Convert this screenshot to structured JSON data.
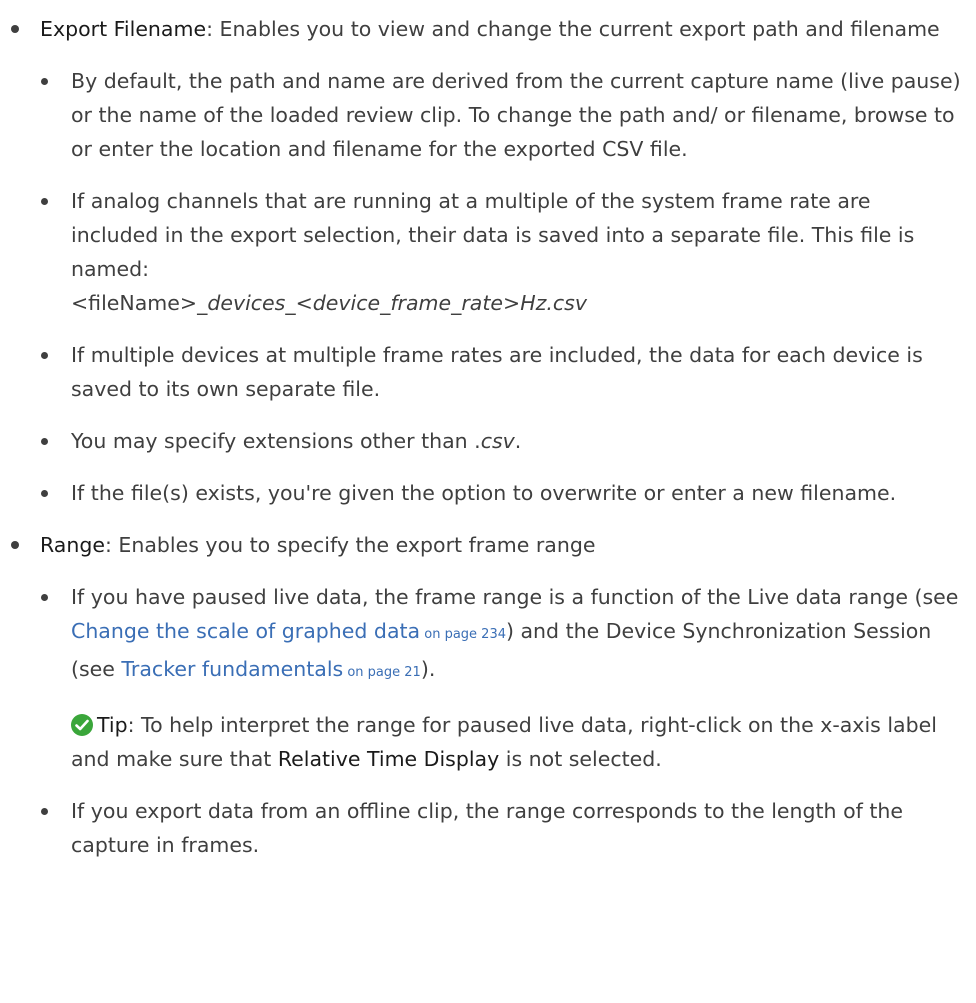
{
  "export_filename": {
    "term": "Export Filename",
    "desc": ": Enables you to view and change the current export path and filename",
    "sub": [
      {
        "text": "By default, the path and name are derived from the current capture name (live pause) or the name of the loaded review clip. To change the path and/ or filename, browse to or enter the location and filename for the exported CSV file."
      },
      {
        "text_a": "If analog channels that are running at a multiple of the system frame rate are included in the export selection, their data is saved into a separate file. This file is named:",
        "file_prefix": "<fileName>",
        "file_italic": "_devices_<device_frame_rate>Hz.csv"
      },
      {
        "text": "If multiple devices at multiple frame rates are included, the data for each device is saved to its own separate file."
      },
      {
        "text_a": "You may specify extensions other than .",
        "text_italic": "csv",
        "text_b": "."
      },
      {
        "text": "If the file(s) exists, you're given the option to overwrite or enter a new filename."
      }
    ]
  },
  "range": {
    "term": "Range",
    "desc": ": Enables you to specify the export frame range",
    "sub1": {
      "t1": "If you have paused live data, the frame range is a function of the Live data range (see ",
      "link1": "Change the scale of graphed data",
      "page1": " on page 234",
      "t2": ") and the Device Synchronization Session (see ",
      "link2": "Tracker fundamentals",
      "page2": " on page 21",
      "t3": ")."
    },
    "tip": {
      "label": "Tip",
      "t1": ": To help interpret the range for paused live data, right-click on the x-axis label and make sure that ",
      "term": "Relative Time Display",
      "t2": " is not selected."
    },
    "sub2": {
      "text": "If you export data from an offline clip, the range corresponds to the length of the capture in frames."
    }
  },
  "colors": {
    "text": "#3f3f3f",
    "link": "#3a6eb5",
    "tip_icon": "#3aa63a"
  }
}
